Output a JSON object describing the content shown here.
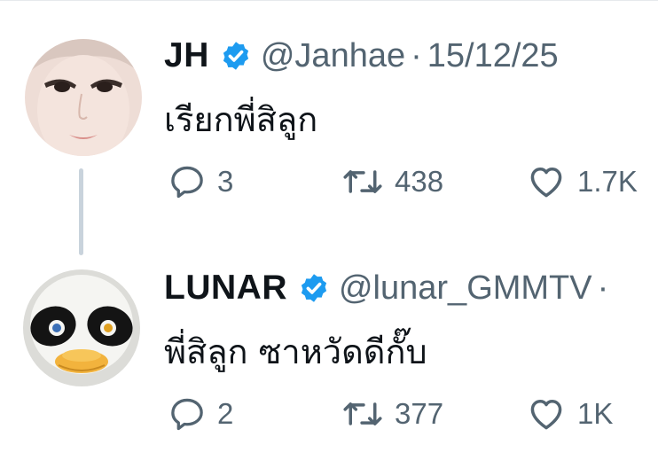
{
  "tweets": [
    {
      "name": "JH",
      "handle": "@Janhae",
      "separator": "·",
      "date": "15/12/25",
      "text": "เรียกพี่สิลูก",
      "replies": "3",
      "retweets": "438",
      "likes": "1.7K"
    },
    {
      "name": "LUNAR",
      "handle": "@lunar_GMMTV",
      "separator": "·",
      "text": "พี่สิลูก ซาหวัดดีกั๊บ",
      "replies": "2",
      "retweets": "377",
      "likes": "1K"
    }
  ],
  "colors": {
    "verified": "#1d9bf0",
    "secondary_text": "#536471",
    "thread_line": "#c9d3dc"
  },
  "icons": [
    "verified-badge-icon",
    "reply-icon",
    "retweet-icon",
    "like-icon"
  ]
}
